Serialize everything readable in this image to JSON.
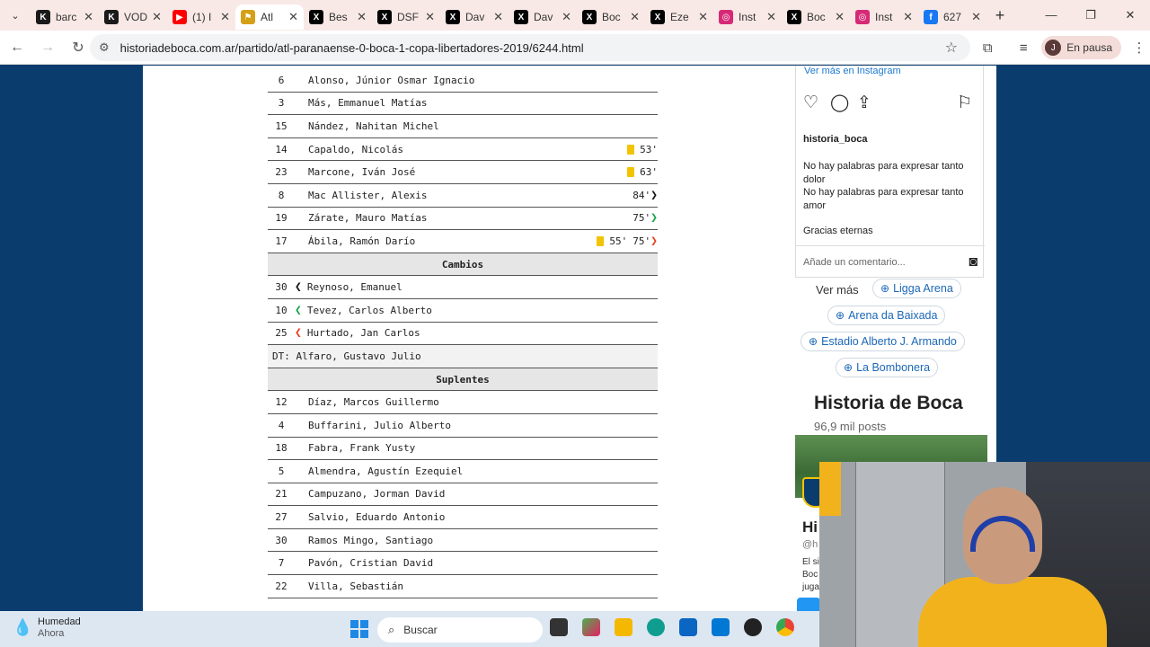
{
  "browser": {
    "tabs": [
      {
        "title": "barc",
        "favicon_color": "#1a1a1a",
        "favicon_glyph": "K",
        "active": false
      },
      {
        "title": "VOD",
        "favicon_color": "#1a1a1a",
        "favicon_glyph": "K",
        "active": false
      },
      {
        "title": "(1) I",
        "favicon_color": "#ff0000",
        "favicon_glyph": "▶",
        "active": false
      },
      {
        "title": "Atl",
        "favicon_color": "#d4a017",
        "favicon_glyph": "⚑",
        "active": true
      },
      {
        "title": "Bes",
        "favicon_color": "#000000",
        "favicon_glyph": "X",
        "active": false
      },
      {
        "title": "DSF",
        "favicon_color": "#000000",
        "favicon_glyph": "X",
        "active": false
      },
      {
        "title": "Dav",
        "favicon_color": "#000000",
        "favicon_glyph": "X",
        "active": false
      },
      {
        "title": "Dav",
        "favicon_color": "#000000",
        "favicon_glyph": "X",
        "active": false
      },
      {
        "title": "Boc",
        "favicon_color": "#000000",
        "favicon_glyph": "X",
        "active": false
      },
      {
        "title": "Eze",
        "favicon_color": "#000000",
        "favicon_glyph": "X",
        "active": false
      },
      {
        "title": "Inst",
        "favicon_color": "#d62976",
        "favicon_glyph": "◎",
        "active": false
      },
      {
        "title": "Boc",
        "favicon_color": "#000000",
        "favicon_glyph": "X",
        "active": false
      },
      {
        "title": "Inst",
        "favicon_color": "#d62976",
        "favicon_glyph": "◎",
        "active": false
      },
      {
        "title": "627",
        "favicon_color": "#1877f2",
        "favicon_glyph": "f",
        "active": false
      }
    ],
    "url": "historiadeboca.com.ar/partido/atl-paranaense-0-boca-1-copa-libertadores-2019/6244.html",
    "profile_initial": "J",
    "profile_status": "En pausa"
  },
  "lineup": {
    "players": [
      {
        "num": "6",
        "name": "Alonso, Júnior Osmar Ignacio",
        "card": null,
        "sub_min": null,
        "arrow": null
      },
      {
        "num": "3",
        "name": "Más, Emmanuel Matías",
        "card": null,
        "sub_min": null,
        "arrow": null
      },
      {
        "num": "15",
        "name": "Nández, Nahitan Michel",
        "card": null,
        "sub_min": null,
        "arrow": null
      },
      {
        "num": "14",
        "name": "Capaldo, Nicolás",
        "card": "53'",
        "sub_min": null,
        "arrow": null
      },
      {
        "num": "23",
        "name": "Marcone, Iván José",
        "card": "63'",
        "sub_min": null,
        "arrow": null
      },
      {
        "num": "8",
        "name": "Mac Allister, Alexis",
        "card": null,
        "sub_min": "84'",
        "arrow": "black"
      },
      {
        "num": "19",
        "name": "Zárate, Mauro Matías",
        "card": null,
        "sub_min": "75'",
        "arrow": "green"
      },
      {
        "num": "17",
        "name": "Ábila, Ramón Darío",
        "card": "55'",
        "sub_min": "75'",
        "arrow": "red"
      }
    ],
    "cambios_title": "Cambios",
    "cambios": [
      {
        "num": "30",
        "name": "Reynoso, Emanuel",
        "arrow": "black"
      },
      {
        "num": "10",
        "name": "Tevez, Carlos Alberto",
        "arrow": "green"
      },
      {
        "num": "25",
        "name": "Hurtado, Jan Carlos",
        "arrow": "red"
      }
    ],
    "dt": "DT: Alfaro, Gustavo Julio",
    "suplentes_title": "Suplentes",
    "suplentes": [
      {
        "num": "12",
        "name": "Díaz, Marcos Guillermo"
      },
      {
        "num": "4",
        "name": "Buffarini, Julio Alberto"
      },
      {
        "num": "18",
        "name": "Fabra, Frank Yusty"
      },
      {
        "num": "5",
        "name": "Almendra, Agustín Ezequiel"
      },
      {
        "num": "21",
        "name": "Campuzano, Jorman David"
      },
      {
        "num": "27",
        "name": "Salvio, Eduardo Antonio"
      },
      {
        "num": "30",
        "name": "Ramos Mingo, Santiago"
      },
      {
        "num": "7",
        "name": "Pavón, Cristian David"
      },
      {
        "num": "22",
        "name": "Villa, Sebastián"
      }
    ]
  },
  "instagram": {
    "view_more": "Ver más en Instagram",
    "username": "historia_boca",
    "caption": [
      "No hay palabras para expresar tanto dolor",
      "No hay palabras para expresar tanto amor",
      "",
      "Gracias eternas"
    ],
    "comment_placeholder": "Añade un comentario..."
  },
  "venues": {
    "ver_mas": "Ver más",
    "chips": [
      "Ligga Arena",
      "Arena da Baixada",
      "Estadio Alberto J. Armando",
      "La Bombonera"
    ]
  },
  "profile_box": {
    "title": "Historia de Boca",
    "posts": "96,9 mil posts",
    "name": "Hi",
    "handle": "@h",
    "bio": [
      "El si",
      "Boc",
      "juga"
    ]
  },
  "taskbar": {
    "weather_title": "Humedad",
    "weather_sub": "Ahora",
    "search_placeholder": "Buscar"
  }
}
